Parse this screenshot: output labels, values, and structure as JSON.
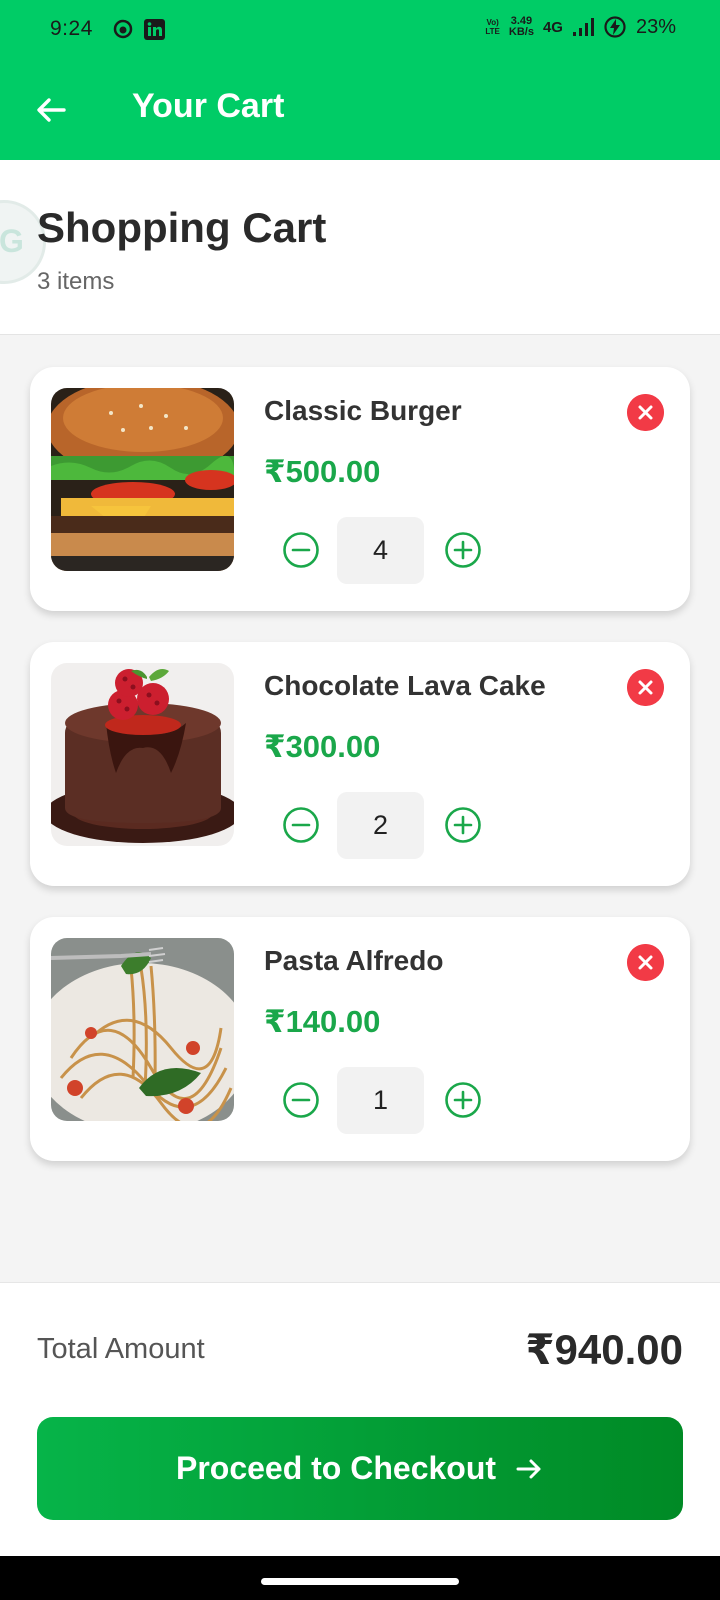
{
  "status_bar": {
    "time": "9:24",
    "volte_top": "Vo)",
    "volte_bottom": "LTE",
    "speed_value": "3.49",
    "speed_unit": "KB/s",
    "network": "4G",
    "battery": "23%",
    "icons": [
      "circle-notification-icon",
      "linkedin-icon",
      "signal-icon",
      "battery-charging-icon"
    ]
  },
  "app_bar": {
    "title": "Your Cart",
    "back_icon": "arrow-left-icon"
  },
  "header": {
    "logo_letter": "G",
    "title": "Shopping Cart",
    "item_count": "3 items"
  },
  "cart": {
    "items": [
      {
        "name": "Classic Burger",
        "price": "₹500.00",
        "quantity": "4",
        "image": "burger"
      },
      {
        "name": "Chocolate Lava Cake",
        "price": "₹300.00",
        "quantity": "2",
        "image": "lava-cake"
      },
      {
        "name": "Pasta Alfredo",
        "price": "₹140.00",
        "quantity": "1",
        "image": "pasta"
      }
    ]
  },
  "footer": {
    "total_label": "Total Amount",
    "total_value": "₹940.00",
    "checkout_label": "Proceed to Checkout"
  },
  "colors": {
    "brand_green": "#00cc66",
    "price_green": "#1aa74a",
    "remove_red": "#f23a46",
    "checkout_gradient_start": "#06b449",
    "checkout_gradient_end": "#008a25"
  }
}
